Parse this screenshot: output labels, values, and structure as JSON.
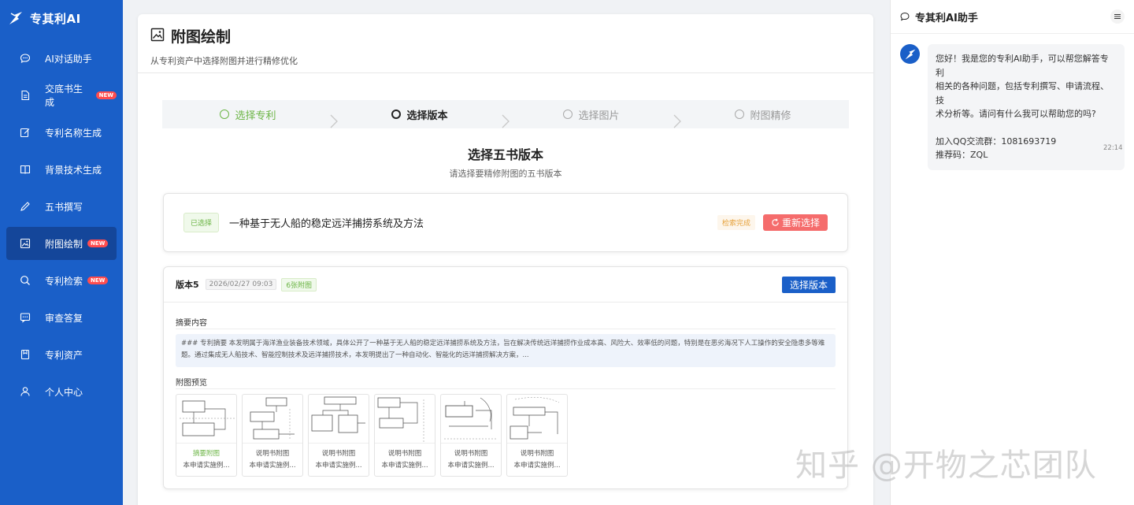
{
  "brand": {
    "name": "专其利AI"
  },
  "sidebar": {
    "items": [
      {
        "label": "AI对话助手",
        "icon": "chat-icon",
        "new": false,
        "active": false
      },
      {
        "label": "交底书生成",
        "icon": "document-icon",
        "new": true,
        "active": false
      },
      {
        "label": "专利名称生成",
        "icon": "edit-icon",
        "new": false,
        "active": false
      },
      {
        "label": "背景技术生成",
        "icon": "book-icon",
        "new": false,
        "active": false
      },
      {
        "label": "五书撰写",
        "icon": "pen-icon",
        "new": false,
        "active": false
      },
      {
        "label": "附图绘制",
        "icon": "image-icon",
        "new": true,
        "active": true
      },
      {
        "label": "专利检索",
        "icon": "search-icon",
        "new": true,
        "active": false
      },
      {
        "label": "审查答复",
        "icon": "reply-icon",
        "new": false,
        "active": false
      },
      {
        "label": "专利资产",
        "icon": "asset-icon",
        "new": false,
        "active": false
      },
      {
        "label": "个人中心",
        "icon": "user-icon",
        "new": false,
        "active": false
      }
    ],
    "new_badge": "NEW"
  },
  "page": {
    "title": "附图绘制",
    "subtitle": "从专利资产中选择附图并进行精修优化"
  },
  "steps": [
    {
      "label": "选择专利",
      "state": "done"
    },
    {
      "label": "选择版本",
      "state": "current"
    },
    {
      "label": "选择图片",
      "state": "pending"
    },
    {
      "label": "附图精修",
      "state": "pending"
    }
  ],
  "section": {
    "title": "选择五书版本",
    "subtitle": "请选择要精修附图的五书版本"
  },
  "selected": {
    "tag": "已选择",
    "patent_name": "一种基于无人船的稳定远洋捕捞系统及方法",
    "status": "检索完成",
    "reselect_label": "重新选择"
  },
  "version": {
    "name": "版本5",
    "date": "2026/02/27 09:03",
    "count": "6张附图",
    "choose_label": "选择版本",
    "abstract_label": "摘要内容",
    "abstract_text": "### 专利摘要 本发明属于海洋渔业装备技术领域，具体公开了一种基于无人船的稳定远洋捕捞系统及方法，旨在解决传统远洋捕捞作业成本高、风险大、效率低的问题，特别是在恶劣海况下人工操作的安全隐患多等难题。通过集成无人船技术、智能控制技术及远洋捕捞技术，本发明提出了一种自动化、智能化的远洋捕捞解决方案，...",
    "preview_label": "附图预览",
    "thumbs": [
      {
        "type": "摘要附图",
        "desc": "本申请实施例...",
        "highlight": true
      },
      {
        "type": "说明书附图",
        "desc": "本申请实施例...",
        "highlight": false
      },
      {
        "type": "说明书附图",
        "desc": "本申请实施例...",
        "highlight": false
      },
      {
        "type": "说明书附图",
        "desc": "本申请实施例...",
        "highlight": false
      },
      {
        "type": "说明书附图",
        "desc": "本申请实施例...",
        "highlight": false
      },
      {
        "type": "说明书附图",
        "desc": "本申请实施例...",
        "highlight": false
      }
    ]
  },
  "chat": {
    "title": "专其利AI助手",
    "message_lines": [
      "您好！我是您的专利AI助手，可以帮您解答专利",
      "相关的各种问题，包括专利撰写、申请流程、技",
      "术分析等。请问有什么我可以帮助您的吗?"
    ],
    "message_extra": [
      "加入QQ交流群：1081693719",
      "推荐码：ZQL"
    ],
    "time": "22:14"
  },
  "watermark": "知乎 @开物之芯团队",
  "colors": {
    "primary": "#1a5fc8",
    "active": "#14469a",
    "success": "#6cb546",
    "danger": "#f56c6c",
    "warning": "#e6a23c"
  }
}
